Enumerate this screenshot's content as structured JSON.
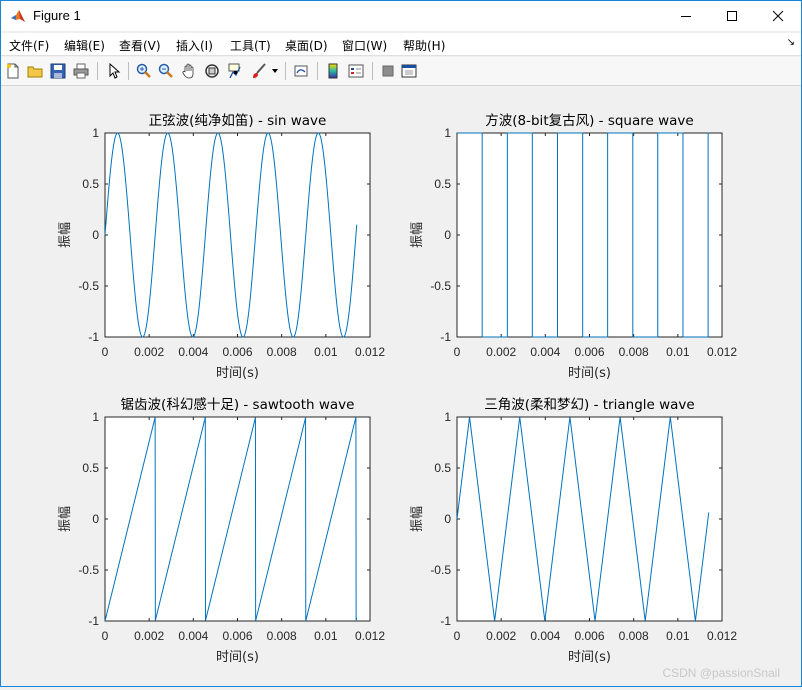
{
  "window": {
    "title": "Figure 1",
    "menu": [
      "文件(F)",
      "编辑(E)",
      "查看(V)",
      "插入(I)",
      "工具(T)",
      "桌面(D)",
      "窗口(W)",
      "帮助(H)"
    ],
    "menu_arrow": "↘"
  },
  "toolbar": {
    "icons": [
      "new-figure-icon",
      "open-file-icon",
      "save-icon",
      "print-icon",
      "pointer-icon",
      "zoom-in-icon",
      "zoom-out-icon",
      "pan-icon",
      "rotate-3d-icon",
      "data-cursor-icon",
      "brush-icon",
      "brush-dropdown-icon",
      "link-plot-icon",
      "insert-colorbar-icon",
      "insert-legend-icon",
      "hide-plot-tools-icon",
      "show-plot-tools-icon"
    ]
  },
  "watermark": "CSDN @passionSnail",
  "colors": {
    "line": "#0072bd",
    "axes": "#262626",
    "window_border": "#1883d7"
  },
  "chart_data": [
    {
      "type": "line",
      "title": "正弦波(纯净如笛) - sin wave",
      "xlabel": "时间(s)",
      "ylabel": "振幅",
      "xlim": [
        0,
        0.012
      ],
      "ylim": [
        -1,
        1
      ],
      "xticks": [
        "0",
        "0.002",
        "0.004",
        "0.006",
        "0.008",
        "0.01",
        "0.012"
      ],
      "yticks": [
        "1",
        "0.5",
        "0",
        "-0.5",
        "-1"
      ],
      "waveform": "sine",
      "frequency_hz": 440,
      "duration_s": 0.0114,
      "series": [
        {
          "values_description": ""
        }
      ]
    },
    {
      "type": "line",
      "title": "方波(8-bit复古风) - square wave",
      "xlabel": "时间(s)",
      "ylabel": "振幅",
      "xlim": [
        0,
        0.012
      ],
      "ylim": [
        -1,
        1
      ],
      "xticks": [
        "0",
        "0.002",
        "0.004",
        "0.006",
        "0.008",
        "0.01",
        "0.012"
      ],
      "yticks": [
        "1",
        "0.5",
        "0",
        "-0.5",
        "-1"
      ],
      "waveform": "square",
      "frequency_hz": 440,
      "duration_s": 0.0114
    },
    {
      "type": "line",
      "title": "锯齿波(科幻感十足) - sawtooth wave",
      "xlabel": "时间(s)",
      "ylabel": "振幅",
      "xlim": [
        0,
        0.012
      ],
      "ylim": [
        -1,
        1
      ],
      "xticks": [
        "0",
        "0.002",
        "0.004",
        "0.006",
        "0.008",
        "0.01",
        "0.012"
      ],
      "yticks": [
        "1",
        "0.5",
        "0",
        "-0.5",
        "-1"
      ],
      "waveform": "sawtooth",
      "frequency_hz": 440,
      "duration_s": 0.0114
    },
    {
      "type": "line",
      "title": "三角波(柔和梦幻) - triangle wave",
      "xlabel": "时间(s)",
      "ylabel": "振幅",
      "xlim": [
        0,
        0.012
      ],
      "ylim": [
        -1,
        1
      ],
      "xticks": [
        "0",
        "0.002",
        "0.004",
        "0.006",
        "0.008",
        "0.01",
        "0.012"
      ],
      "yticks": [
        "1",
        "0.5",
        "0",
        "-0.5",
        "-1"
      ],
      "waveform": "triangle",
      "frequency_hz": 440,
      "duration_s": 0.0114
    }
  ]
}
